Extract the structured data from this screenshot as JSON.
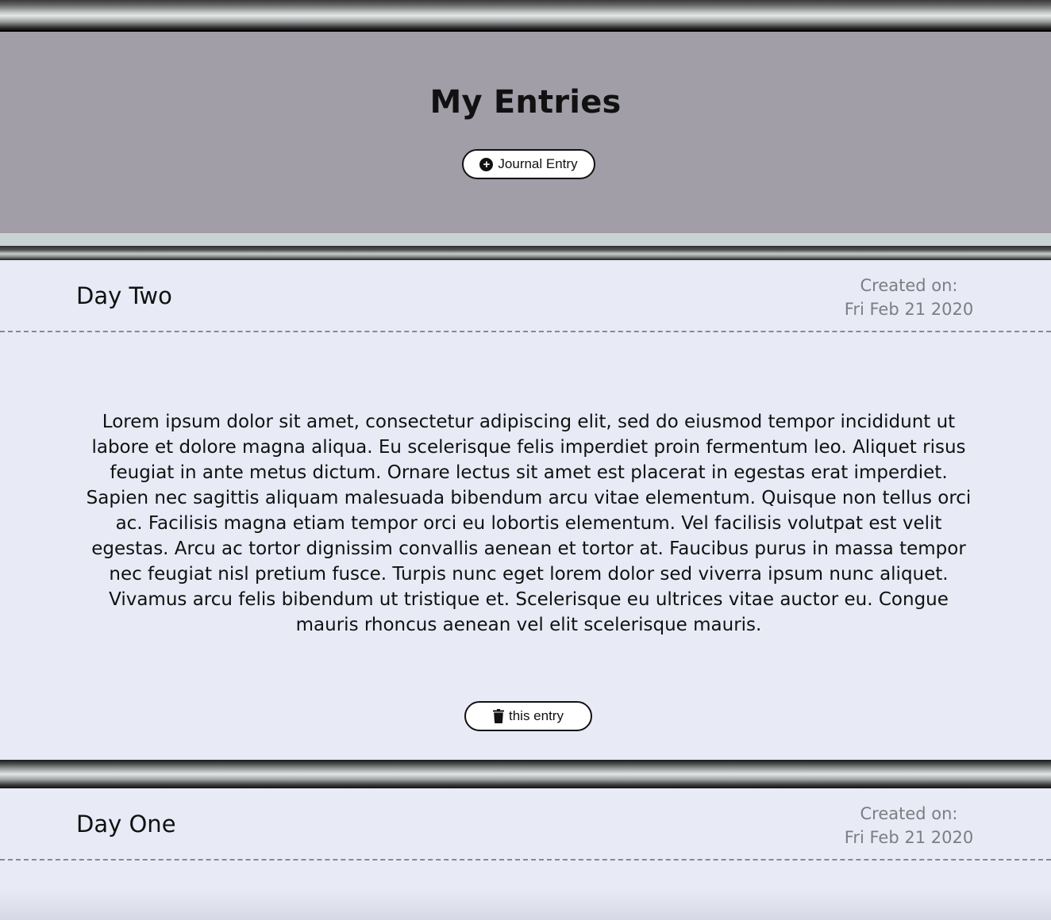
{
  "header": {
    "title": "My Entries",
    "add_button_label": "Journal Entry",
    "add_icon": "plus-circle-icon"
  },
  "entries": [
    {
      "title": "Day Two",
      "created_label": "Created on:",
      "created_date": "Fri Feb 21 2020",
      "body": "Lorem ipsum dolor sit amet, consectetur adipiscing elit, sed do eiusmod tempor incididunt ut labore et dolore magna aliqua. Eu scelerisque felis imperdiet proin fermentum leo. Aliquet risus feugiat in ante metus dictum. Ornare lectus sit amet est placerat in egestas erat imperdiet. Sapien nec sagittis aliquam malesuada bibendum arcu vitae elementum. Quisque non tellus orci ac. Facilisis magna etiam tempor orci eu lobortis elementum. Vel facilisis volutpat est velit egestas. Arcu ac tortor dignissim convallis aenean et tortor at. Faucibus purus in massa tempor nec feugiat nisl pretium fusce. Turpis nunc eget lorem dolor sed viverra ipsum nunc aliquet. Vivamus arcu felis bibendum ut tristique et. Scelerisque eu ultrices vitae auctor eu. Congue mauris rhoncus aenean vel elit scelerisque mauris.",
      "delete_button_label": "this entry",
      "delete_icon": "trash-icon"
    },
    {
      "title": "Day One",
      "created_label": "Created on:",
      "created_date": "Fri Feb 21 2020"
    }
  ],
  "colors": {
    "header_bg": "#a19ea8",
    "page_bg": "#e8eaf6",
    "muted_text": "#7d7d82"
  }
}
